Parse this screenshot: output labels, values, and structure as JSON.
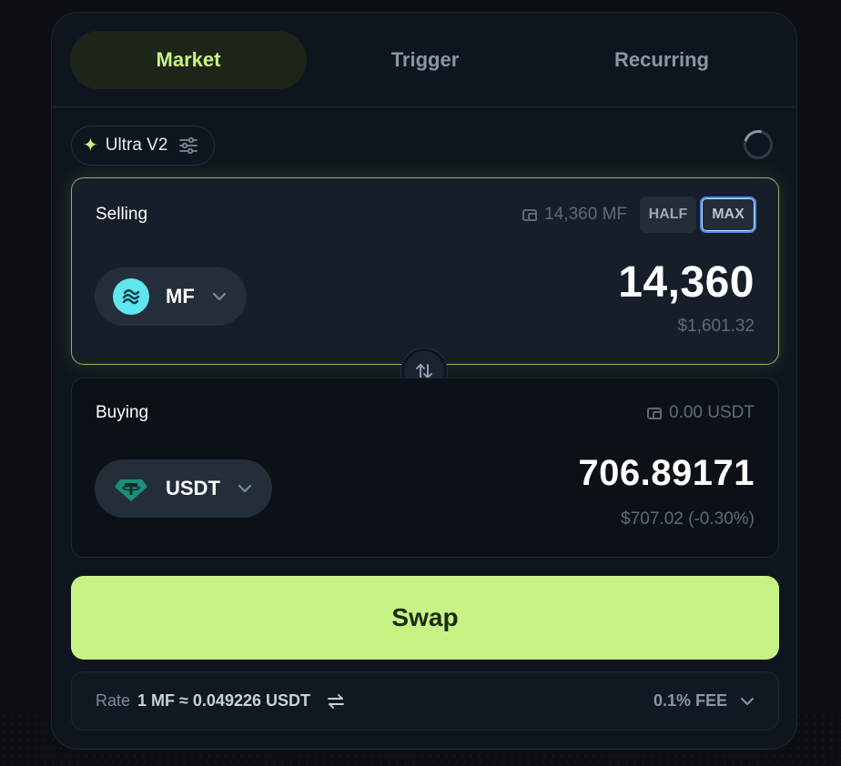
{
  "tabs": [
    {
      "label": "Market",
      "active": true
    },
    {
      "label": "Trigger",
      "active": false
    },
    {
      "label": "Recurring",
      "active": false
    }
  ],
  "router": {
    "label": "Ultra V2",
    "icon": "sparkle-icon"
  },
  "selling": {
    "label": "Selling",
    "balance": "14,360 MF",
    "half_label": "HALF",
    "max_label": "MAX",
    "token": "MF",
    "amount": "14,360",
    "usd_value": "$1,601.32"
  },
  "buying": {
    "label": "Buying",
    "balance": "0.00 USDT",
    "token": "USDT",
    "amount": "706.89171",
    "usd_value": "$707.02 (-0.30%)"
  },
  "swap_label": "Swap",
  "rate": {
    "label": "Rate",
    "value": "1 MF ≈ 0.049226 USDT",
    "fee": "0.1% FEE"
  },
  "colors": {
    "accent": "#c7f284",
    "panel_bg": "#0f151d",
    "max_border": "#4a8ff0"
  }
}
